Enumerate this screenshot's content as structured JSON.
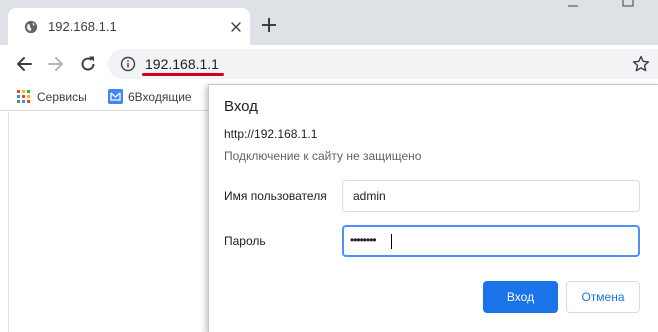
{
  "tab": {
    "title": "192.168.1.1",
    "favicon": "globe-icon",
    "close_icon": "close-icon"
  },
  "new_tab_icon": "plus-icon",
  "toolbar": {
    "back_icon": "back-arrow-icon",
    "forward_icon": "forward-arrow-icon",
    "reload_icon": "reload-icon",
    "info_icon": "info-icon",
    "url": "192.168.1.1",
    "bookmark_star_icon": "star-icon",
    "url_underline_color": "#d0021b"
  },
  "bookmarks": [
    {
      "label": "Сервисы",
      "icon": "apps-grid-icon"
    },
    {
      "label": "6Входящие",
      "icon": "mail-icon"
    }
  ],
  "dialog": {
    "title": "Вход",
    "site_url": "http://192.168.1.1",
    "warning": "Подключение к сайту не защищено",
    "username_label": "Имя пользователя",
    "username_value": "admin",
    "password_label": "Пароль",
    "password_mask": "••••••••",
    "sign_in_label": "Вход",
    "cancel_label": "Отмена",
    "primary_color": "#1a73e8"
  }
}
